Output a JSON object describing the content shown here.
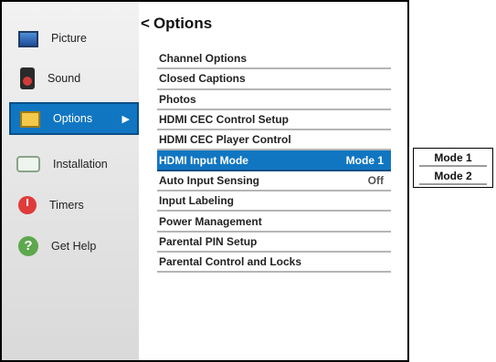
{
  "sidebar": {
    "items": [
      {
        "label": "Picture",
        "icon": "picture-icon"
      },
      {
        "label": "Sound",
        "icon": "speaker-icon"
      },
      {
        "label": "Options",
        "icon": "options-icon",
        "selected": true,
        "arrow": "▶"
      },
      {
        "label": "Installation",
        "icon": "installation-icon"
      },
      {
        "label": "Timers",
        "icon": "timer-icon"
      },
      {
        "label": "Get Help",
        "icon": "help-icon",
        "glyph": "?"
      }
    ]
  },
  "main": {
    "back_glyph": "<",
    "title": "Options",
    "items": [
      {
        "label": "Channel Options",
        "value": ""
      },
      {
        "label": "Closed Captions",
        "value": ""
      },
      {
        "label": "Photos",
        "value": ""
      },
      {
        "label": "HDMI CEC Control Setup",
        "value": ""
      },
      {
        "label": "HDMI CEC Player Control",
        "value": ""
      },
      {
        "label": "HDMI Input Mode",
        "value": "Mode 1",
        "highlight": true
      },
      {
        "label": "Auto Input Sensing",
        "value": "Off"
      },
      {
        "label": "Input Labeling",
        "value": ""
      },
      {
        "label": "Power Management",
        "value": ""
      },
      {
        "label": "Parental PIN Setup",
        "value": ""
      },
      {
        "label": "Parental Control and Locks",
        "value": ""
      }
    ]
  },
  "popup": {
    "options": [
      "Mode 1",
      "Mode 2"
    ]
  },
  "colors": {
    "accent": "#1176c2",
    "sidebar_bg": "#e6e6e6",
    "divider": "#b5b5b5"
  }
}
